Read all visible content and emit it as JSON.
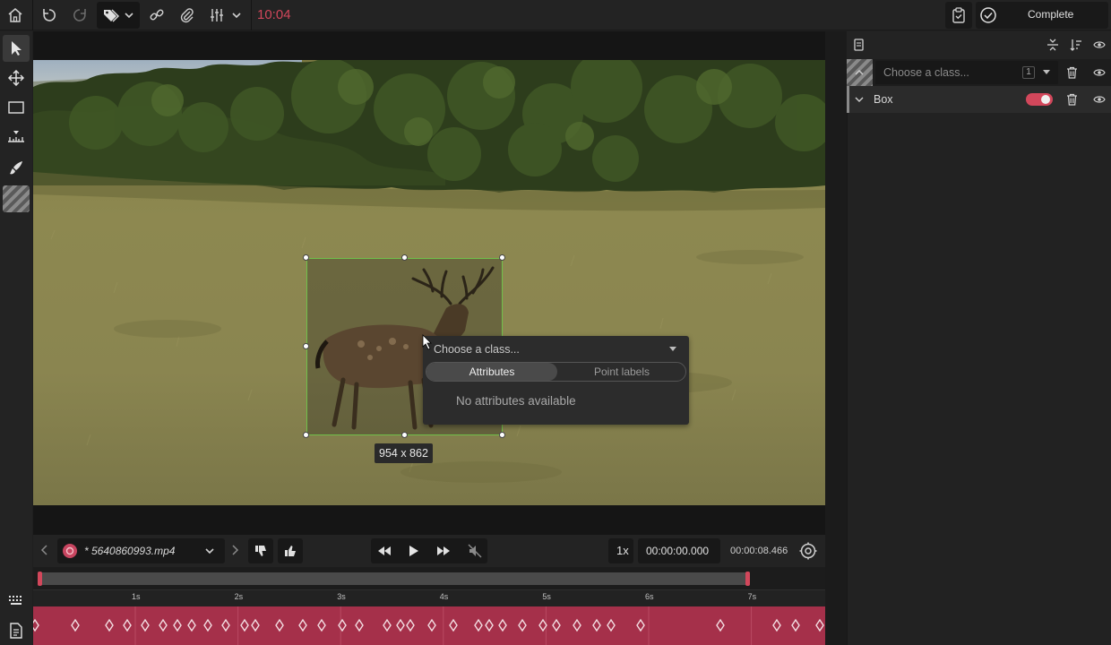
{
  "topbar": {
    "timer": "10:04",
    "complete_label": "Complete"
  },
  "canvas": {
    "bbox_dimensions": "954 x 862"
  },
  "popup": {
    "class_placeholder": "Choose a class...",
    "tabs": [
      "Attributes",
      "Point labels"
    ],
    "active_tab": "Attributes",
    "empty_message": "No attributes available"
  },
  "player": {
    "filename": "* 5640860993.mp4",
    "speed": "1x",
    "current_time": "00:00:00.000",
    "end_time": "00:00:08.466",
    "progress": 0.0
  },
  "timeline": {
    "tick_labels": [
      "1s",
      "2s",
      "3s",
      "4s",
      "5s",
      "6s",
      "7s"
    ]
  },
  "annotations": {
    "rows": [
      {
        "class_placeholder": "Choose a class...",
        "count": "1"
      },
      {
        "label": "Box",
        "visible_toggle": true
      }
    ]
  },
  "colors": {
    "accent": "#d2475b",
    "bbox": "#6fc04a",
    "keyframe_band": "#a5304a"
  }
}
